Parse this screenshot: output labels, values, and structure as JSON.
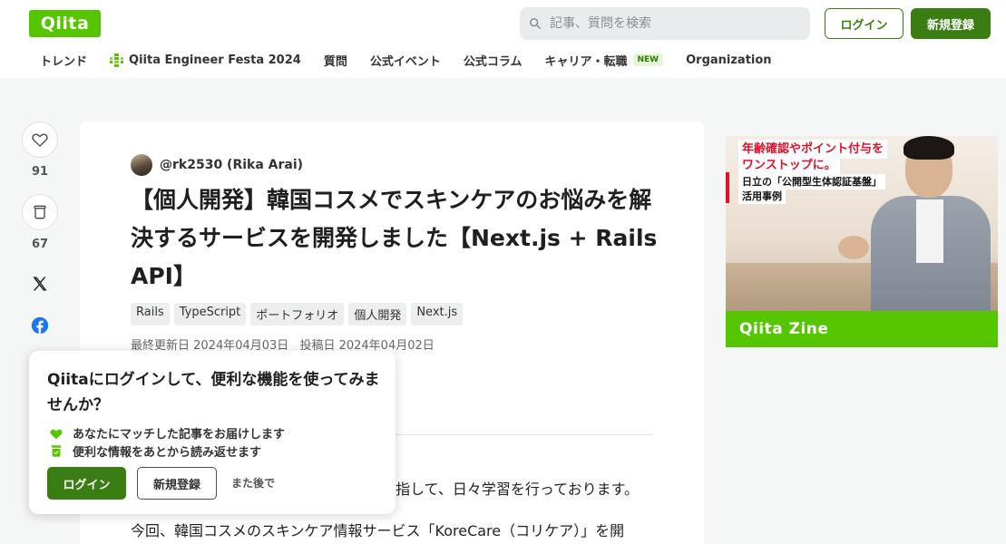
{
  "header": {
    "logo": "Qiita",
    "search_placeholder": "記事、質問を検索",
    "login_label": "ログイン",
    "signup_label": "新規登録"
  },
  "nav": {
    "items": [
      {
        "label": "トレンド"
      },
      {
        "label": "Qiita Engineer Festa 2024",
        "icon": "festa-grid-icon"
      },
      {
        "label": "質問"
      },
      {
        "label": "公式イベント"
      },
      {
        "label": "公式コラム"
      },
      {
        "label": "キャリア・転職",
        "badge": "NEW"
      },
      {
        "label": "Organization"
      }
    ]
  },
  "side_actions": {
    "like_count": "91",
    "stock_count": "67"
  },
  "article": {
    "author": "@rk2530 (Rika Arai)",
    "title": "【個人開発】韓国コスメでスキンケアのお悩みを解決するサービスを開発しました【Next.js + Rails API】",
    "tags": [
      "Rails",
      "TypeScript",
      "ポートフォリオ",
      "個人開発",
      "Next.js"
    ],
    "updated": "最終更新日 2024年04月03日",
    "posted": "投稿日 2024年04月02日",
    "body_line1": "指して、日々学習を行っております。",
    "body_line2": "今回、韓国コスメのスキンケア情報サービス「KoreCare（コリケア）」を開"
  },
  "popup": {
    "title": "Qiitaにログインして、便利な機能を使ってみませんか？",
    "benefit1": "あなたにマッチした記事をお届けします",
    "benefit2": "便利な情報をあとから読み返せます",
    "login_label": "ログイン",
    "signup_label": "新規登録",
    "later_label": "また後で"
  },
  "ad": {
    "headline1": "年齢確認やポイント付与を",
    "headline2": "ワンストップに。",
    "sub1": "日立の「公開型生体認証基盤」",
    "sub2": "活用事例",
    "brand": "Qiita Zine"
  },
  "colors": {
    "brand_green": "#55c500",
    "button_green": "#3a7d12",
    "ad_red": "#e0112b",
    "facebook_blue": "#1877f2"
  }
}
